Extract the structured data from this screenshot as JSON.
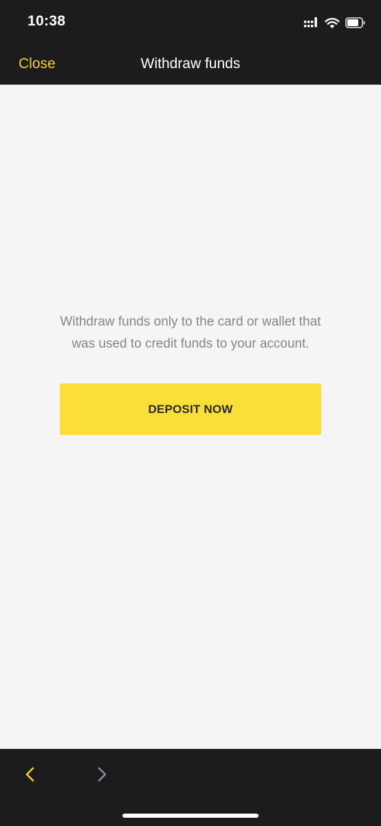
{
  "status_bar": {
    "time": "10:38",
    "icons": [
      "cellular-signal-icon",
      "wifi-icon",
      "battery-icon"
    ]
  },
  "nav_bar": {
    "close_label": "Close",
    "title": "Withdraw funds"
  },
  "main": {
    "message_line1": "Withdraw funds only to the card or wallet that",
    "message_line2": "was used to credit funds to your account.",
    "deposit_button_label": "DEPOSIT NOW"
  },
  "toolbar": {
    "back_icon": "chevron-left-icon",
    "forward_icon": "chevron-right-icon"
  },
  "colors": {
    "accent": "#fcde3a",
    "link": "#f5d02e",
    "bar_background": "#1c1c1e",
    "page_background": "#f5f5f5",
    "message_text": "#85858a",
    "forward_disabled": "#8e8e93"
  }
}
